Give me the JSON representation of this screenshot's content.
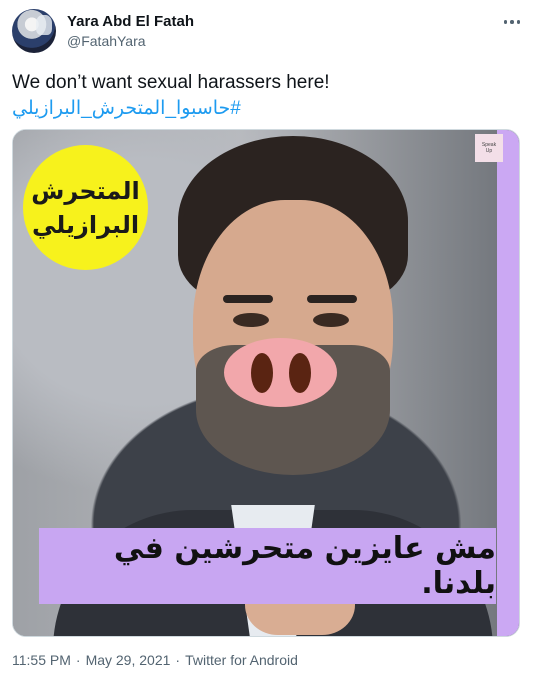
{
  "author": {
    "display_name": "Yara Abd El Fatah",
    "handle": "@FatahYara"
  },
  "tweet": {
    "text": "We don’t want sexual harassers here!",
    "hashtag": "#حاسبوا_المتحرش_البرازيلي"
  },
  "media": {
    "badge_line1": "المتحرش",
    "badge_line2": "البرازيلي",
    "caption": "مش عايزين متحرشين في بلدنا.",
    "logo_text_1": "Speak",
    "logo_text_2": "Up"
  },
  "footer": {
    "time": "11:55 PM",
    "separator": "·",
    "date": "May 29, 2021",
    "source": "Twitter for Android"
  },
  "colors": {
    "link": "#1d9bf0",
    "muted": "#536471",
    "badge": "#f7f21c",
    "caption_bg": "#c8a6f2",
    "pig_nose": "#f2a7ab"
  }
}
